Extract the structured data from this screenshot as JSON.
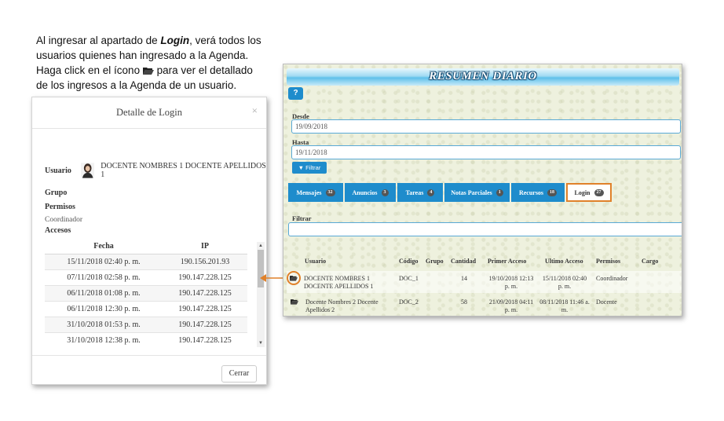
{
  "instructions": {
    "part1": "Al ingresar al apartado de ",
    "login_word": "Login",
    "part2": ", verá todos los usuarios quienes han ingresado a la Agenda. Haga click en el ícono ",
    "part3": " para ver el detallado de los ingresos a la Agenda de un usuario.",
    "icon": "folder-open-icon"
  },
  "modal": {
    "title": "Detalle de Login",
    "close_label": "×",
    "usuario_label": "Usuario",
    "usuario_name": "DOCENTE NOMBRES 1 DOCENTE APELLIDOS 1",
    "grupo_label": "Grupo",
    "permisos_label": "Permisos",
    "permisos_value": "Coordinador",
    "accesos_label": "Accesos",
    "columns": [
      "Fecha",
      "IP"
    ],
    "rows": [
      {
        "fecha": "15/11/2018 02:40 p. m.",
        "ip": "190.156.201.93"
      },
      {
        "fecha": "07/11/2018 02:58 p. m.",
        "ip": "190.147.228.125"
      },
      {
        "fecha": "06/11/2018 01:08 p. m.",
        "ip": "190.147.228.125"
      },
      {
        "fecha": "06/11/2018 12:30 p. m.",
        "ip": "190.147.228.125"
      },
      {
        "fecha": "31/10/2018 01:53 p. m.",
        "ip": "190.147.228.125"
      },
      {
        "fecha": "31/10/2018 12:38 p. m.",
        "ip": "190.147.228.125"
      }
    ],
    "cerrar_label": "Cerrar"
  },
  "app": {
    "banner_title": "RESUMEN DIARIO",
    "help_label": "?",
    "desde_label": "Desde",
    "desde_value": "19/09/2018",
    "hasta_label": "Hasta",
    "hasta_value": "19/11/2018",
    "filtrar_button": "Filtrar",
    "tabs": [
      {
        "label": "Mensajes",
        "count": "32"
      },
      {
        "label": "Anuncios",
        "count": "3"
      },
      {
        "label": "Tareas",
        "count": "4"
      },
      {
        "label": "Notas Parciales",
        "count": "1"
      },
      {
        "label": "Recursos",
        "count": "18"
      },
      {
        "label": "Login",
        "count": "27"
      }
    ],
    "filtrar_label": "Filtrar",
    "table_headers": [
      "Usuario",
      "Código",
      "Grupo",
      "Cantidad",
      "Primer Acceso",
      "Ultimo Acceso",
      "Permisos",
      "Cargo"
    ],
    "table_rows": [
      {
        "usuario": "DOCENTE NOMBRES 1 DOCENTE APELLIDOS 1",
        "codigo": "DOC_1",
        "grupo": "",
        "cantidad": "14",
        "primer": "19/10/2018 12:13 p. m.",
        "ultimo": "15/11/2018 02:40 p. m.",
        "permisos": "Coordinador",
        "cargo": ""
      },
      {
        "usuario": "Docente Nombres 2 Docente Apellidos 2",
        "codigo": "DOC_2",
        "grupo": "",
        "cantidad": "58",
        "primer": "21/09/2018 04:11 p. m.",
        "ultimo": "08/11/2018 11:46 a. m.",
        "permisos": "Docente",
        "cargo": ""
      }
    ]
  },
  "colors": {
    "accent_blue": "#1e8ccc",
    "highlight_orange": "#e0812a"
  }
}
